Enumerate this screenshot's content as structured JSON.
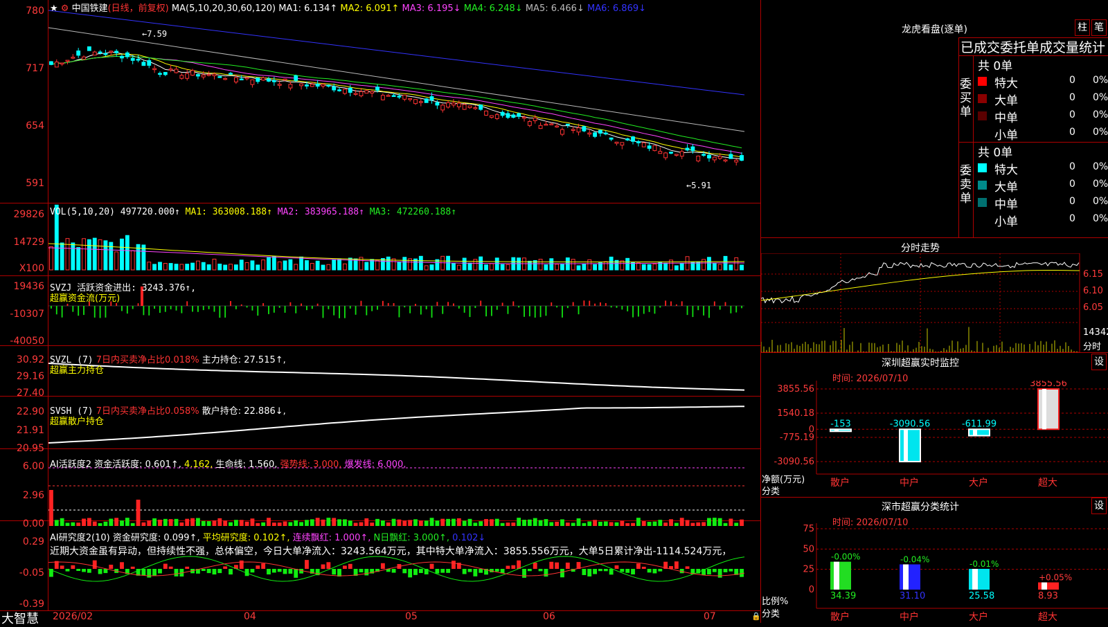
{
  "header": {
    "title": "中国铁建",
    "mode": "(日线，前复权)",
    "ma_label": "MA(5,10,20,30,60,120)",
    "ma1": "MA1: 6.134↑",
    "ma2": "MA2: 6.091↑",
    "ma3": "MA3: 6.195↓",
    "ma4": "MA4: 6.248↓",
    "ma5": "MA5: 6.466↓",
    "ma6": "MA6: 6.869↓"
  },
  "price_axis": [
    "780",
    "717",
    "654",
    "591"
  ],
  "price_marks": {
    "high": "←7.59",
    "low": "←5.91"
  },
  "vol": {
    "axis": [
      "29826",
      "14729",
      "X100"
    ],
    "label": "VOL(5,10,20)",
    "v": "497720.000↑",
    "ma1": "MA1: 363008.188↑",
    "ma2": "MA2: 383965.188↑",
    "ma3": "MA3: 472260.188↑"
  },
  "svzj": {
    "axis": [
      "19436",
      "-10307",
      "-40050"
    ],
    "label": "SVZJ",
    "text": "活跃资金进出: 3243.376↑,",
    "sub": "超赢资金流(万元)"
  },
  "svzl": {
    "axis": [
      "30.92",
      "29.16",
      "27.40"
    ],
    "label": "SVZL (7)",
    "ratio": "7日内买卖净占比0.018%",
    "text": "主力持仓: 27.515↑,",
    "sub": "超赢主力持仓"
  },
  "svsh": {
    "axis": [
      "22.90",
      "21.91",
      "20.95"
    ],
    "label": "SVSH (7)",
    "ratio": "7日内买卖净占比0.058%",
    "text": "散户持仓: 22.886↓,",
    "sub": "超赢散户持仓"
  },
  "ai1": {
    "axis": [
      "6.00",
      "2.96",
      "0.00"
    ],
    "label": "AI活跃度2",
    "t1": "资金活跃度: 0.601↑,",
    "t2": "4.162,",
    "t3": "生命线: 1.560,",
    "t4": "强势线: 3.000,",
    "t5": "爆发线: 6.000,"
  },
  "ai2": {
    "axis": [
      "0.29",
      "-0.05",
      "-0.39"
    ],
    "label": "AI研究度2(10)",
    "t1": "资金研究度: 0.099↑,",
    "t2": "平均研究度: 0.102↑,",
    "t3": "连续飘红: 1.000↑,",
    "t4": "N日飘红: 3.000↑,",
    "t5": "0.102↓",
    "commentary": "近期大资金虽有异动，但持续性不强，总体偏空，今日大单净流入：3243.564万元，其中特大单净流入：3855.556万元，大单5日累计净出-1114.524万元，"
  },
  "bottom": {
    "brand": "大智慧",
    "dates": [
      "2026/02",
      "04",
      "05",
      "06",
      "07"
    ]
  },
  "right": {
    "title": "龙虎看盘(逐单)",
    "btn1": "柱",
    "btn2": "笔",
    "stat_title": "已成交委托单成交量统计",
    "buy_label": "委买单",
    "sell_label": "委卖单",
    "buy_total": "共 0单",
    "sell_total": "共 0单",
    "buy_rows": [
      {
        "name": "特大",
        "count": "0",
        "pct": "0%",
        "color": "#ff0000"
      },
      {
        "name": "大单",
        "count": "0",
        "pct": "0%",
        "color": "#8b0000"
      },
      {
        "name": "中单",
        "count": "0",
        "pct": "0%",
        "color": "#5a0000"
      },
      {
        "name": "小单",
        "count": "0",
        "pct": "0%",
        "color": "#000000"
      }
    ],
    "sell_rows": [
      {
        "name": "特大",
        "count": "0",
        "pct": "0%",
        "color": "#00ffff"
      },
      {
        "name": "大单",
        "count": "0",
        "pct": "0%",
        "color": "#008b8b"
      },
      {
        "name": "中单",
        "count": "0",
        "pct": "0%",
        "color": "#007070"
      },
      {
        "name": "小单",
        "count": "0",
        "pct": "0%",
        "color": "#000000"
      }
    ],
    "intraday_title": "分时走势",
    "intraday_axis": [
      "6.15",
      "6.10",
      "6.05"
    ],
    "intraday_vol": "14342",
    "intraday_vol_unit": "分时",
    "sz_title": "深圳超赢实时监控",
    "sz_btn": "设",
    "sz_time": "时间: 2026/07/10",
    "sz_axis": [
      "3855.56",
      "1540.18",
      "0",
      "-775.19",
      "-3090.56"
    ],
    "sz_ylabel": "净额(万元)",
    "sz_xlabel": "分类",
    "sz_bars": [
      {
        "cat": "散户",
        "value": -153,
        "label": "-153"
      },
      {
        "cat": "中户",
        "value": -3090.56,
        "label": "-3090.56"
      },
      {
        "cat": "大户",
        "value": -611.99,
        "label": "-611.99"
      },
      {
        "cat": "超大",
        "value": 3855.56,
        "label": "3855.56"
      }
    ],
    "cls_title": "深市超赢分类统计",
    "cls_btn": "设",
    "cls_time": "时间: 2026/07/10",
    "cls_axis": [
      "75",
      "50",
      "25",
      "0"
    ],
    "cls_ylabel": "比例%",
    "cls_xlabel": "分类",
    "cls_bars": [
      {
        "cat": "散户",
        "value": 34.39,
        "label": "34.39",
        "delta": "-0.00%"
      },
      {
        "cat": "中户",
        "value": 31.1,
        "label": "31.10",
        "delta": "-0.04%"
      },
      {
        "cat": "大户",
        "value": 25.58,
        "label": "25.58",
        "delta": "-0.01%"
      },
      {
        "cat": "超大",
        "value": 8.93,
        "label": "8.93",
        "delta": "+0.05%"
      }
    ]
  }
}
